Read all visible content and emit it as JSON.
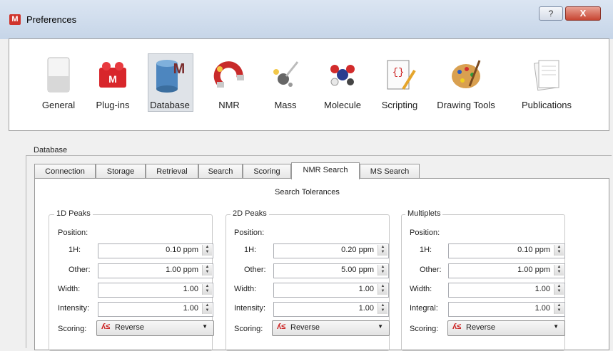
{
  "window": {
    "title": "Preferences",
    "help_label": "?",
    "close_label": "X"
  },
  "toolbar": {
    "items": [
      {
        "label": "General",
        "icon": "general-icon"
      },
      {
        "label": "Plug-ins",
        "icon": "plugins-icon"
      },
      {
        "label": "Database",
        "icon": "database-icon",
        "selected": true
      },
      {
        "label": "NMR",
        "icon": "nmr-magnet-icon"
      },
      {
        "label": "Mass",
        "icon": "mass-icon"
      },
      {
        "label": "Molecule",
        "icon": "molecule-icon"
      },
      {
        "label": "Scripting",
        "icon": "scripting-scroll-icon"
      },
      {
        "label": "Drawing Tools",
        "icon": "palette-icon"
      },
      {
        "label": "Publications",
        "icon": "publications-icon"
      }
    ]
  },
  "database": {
    "group_title": "Database",
    "tabs": [
      {
        "label": "Connection",
        "active": false
      },
      {
        "label": "Storage",
        "active": false
      },
      {
        "label": "Retrieval",
        "active": false
      },
      {
        "label": "Search",
        "active": false
      },
      {
        "label": "Scoring",
        "active": false
      },
      {
        "label": "NMR Search",
        "active": true
      },
      {
        "label": "MS Search",
        "active": false
      }
    ],
    "section_title": "Search Tolerances",
    "groups": [
      {
        "title": "1D Peaks",
        "position_label": "Position:",
        "row1_label": "1H:",
        "row1_value": "0.10 ppm",
        "row2_label": "Other:",
        "row2_value": "1.00 ppm",
        "row3_label": "Width:",
        "row3_value": "1.00",
        "row4_label": "Intensity:",
        "row4_value": "1.00",
        "scoring_label": "Scoring:",
        "scoring_value": "Reverse"
      },
      {
        "title": "2D Peaks",
        "position_label": "Position:",
        "row1_label": "1H:",
        "row1_value": "0.20 ppm",
        "row2_label": "Other:",
        "row2_value": "5.00 ppm",
        "row3_label": "Width:",
        "row3_value": "1.00",
        "row4_label": "Intensity:",
        "row4_value": "1.00",
        "scoring_label": "Scoring:",
        "scoring_value": "Reverse"
      },
      {
        "title": "Multiplets",
        "position_label": "Position:",
        "row1_label": "1H:",
        "row1_value": "0.10 ppm",
        "row2_label": "Other:",
        "row2_value": "1.00 ppm",
        "row3_label": "Width:",
        "row3_value": "1.00",
        "row4_label": "Integral:",
        "row4_value": "1.00",
        "scoring_label": "Scoring:",
        "scoring_value": "Reverse"
      }
    ]
  },
  "colors": {
    "accent_red": "#d0342c",
    "panel_bg": "#ffffff",
    "window_bg": "#f0f0f0"
  }
}
